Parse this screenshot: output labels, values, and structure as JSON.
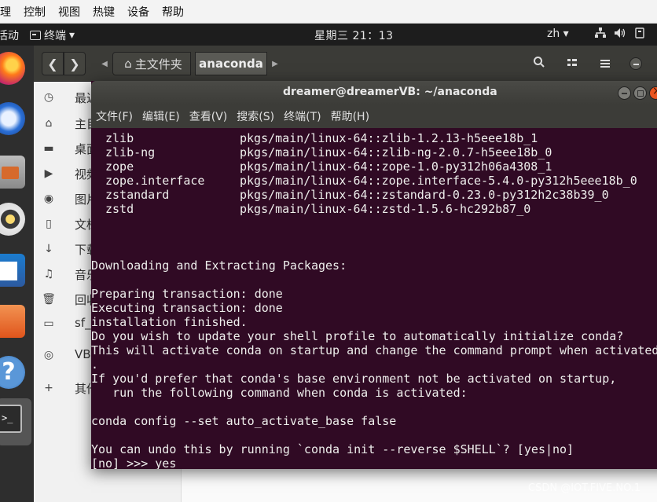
{
  "vbox_menu": [
    "理",
    "控制",
    "视图",
    "热键",
    "设备",
    "帮助"
  ],
  "topbar": {
    "activities": "活动",
    "app_name": "终端",
    "app_caret": "▾",
    "clock": "星期三 21：13",
    "input_method": "zh ▾",
    "tray_icons": [
      "network-icon",
      "volume-icon",
      "power-icon"
    ]
  },
  "dock": {
    "apps": [
      "firefox",
      "thunderbird",
      "files",
      "rhythmbox",
      "libreoffice-writer",
      "ubuntu-software",
      "help",
      "terminal"
    ],
    "help_glyph": "?",
    "terminal_glyph": ">_"
  },
  "nautilus": {
    "crumb_home": "主文件夹",
    "crumb_current": "anaconda",
    "sidebar": [
      {
        "icon": "recent-icon",
        "glyph": "◷",
        "label": "最近"
      },
      {
        "icon": "home-icon",
        "glyph": "⌂",
        "label": "主目录"
      },
      {
        "icon": "desktop-icon",
        "glyph": "▬",
        "label": "桌面"
      },
      {
        "icon": "videos-icon",
        "glyph": "▶",
        "label": "视频"
      },
      {
        "icon": "pictures-icon",
        "glyph": "◉",
        "label": "图片"
      },
      {
        "icon": "documents-icon",
        "glyph": "▯",
        "label": "文档"
      },
      {
        "icon": "downloads-icon",
        "glyph": "↓",
        "label": "下载"
      },
      {
        "icon": "music-icon",
        "glyph": "♫",
        "label": "音乐"
      },
      {
        "icon": "trash-icon",
        "glyph": "🗑",
        "label": "回收站"
      },
      {
        "icon": "drive-icon",
        "glyph": "▭",
        "label": "sf_"
      },
      {
        "icon": "disc-icon",
        "glyph": "◎",
        "label": "VB"
      },
      {
        "icon": "add-icon",
        "glyph": "+",
        "label": "其他"
      }
    ]
  },
  "terminal": {
    "title": "dreamer@dreamerVB: ~/anaconda",
    "menu": [
      "文件(F)",
      "编辑(E)",
      "查看(V)",
      "搜索(S)",
      "终端(T)",
      "帮助(H)"
    ],
    "packages": [
      {
        "name": "zlib",
        "spec": "pkgs/main/linux-64::zlib-1.2.13-h5eee18b_1"
      },
      {
        "name": "zlib-ng",
        "spec": "pkgs/main/linux-64::zlib-ng-2.0.7-h5eee18b_0"
      },
      {
        "name": "zope",
        "spec": "pkgs/main/linux-64::zope-1.0-py312h06a4308_1"
      },
      {
        "name": "zope.interface",
        "spec": "pkgs/main/linux-64::zope.interface-5.4.0-py312h5eee18b_0"
      },
      {
        "name": "zstandard",
        "spec": "pkgs/main/linux-64::zstandard-0.23.0-py312h2c38b39_0"
      },
      {
        "name": "zstd",
        "spec": "pkgs/main/linux-64::zstd-1.5.6-hc292b87_0"
      }
    ],
    "lines": [
      "",
      "",
      "",
      "Downloading and Extracting Packages:",
      "",
      "Preparing transaction: done",
      "Executing transaction: done",
      "installation finished.",
      "Do you wish to update your shell profile to automatically initialize conda?",
      "This will activate conda on startup and change the command prompt when activated.",
      ".",
      "If you'd prefer that conda's base environment not be activated on startup,",
      "   run the following command when conda is activated:",
      "",
      "conda config --set auto_activate_base false",
      "",
      "You can undo this by running `conda init --reverse $SHELL`? [yes|no]",
      "[no] >>> yes"
    ]
  },
  "watermark": "CSDN @IOT.FIVE.NO.1"
}
